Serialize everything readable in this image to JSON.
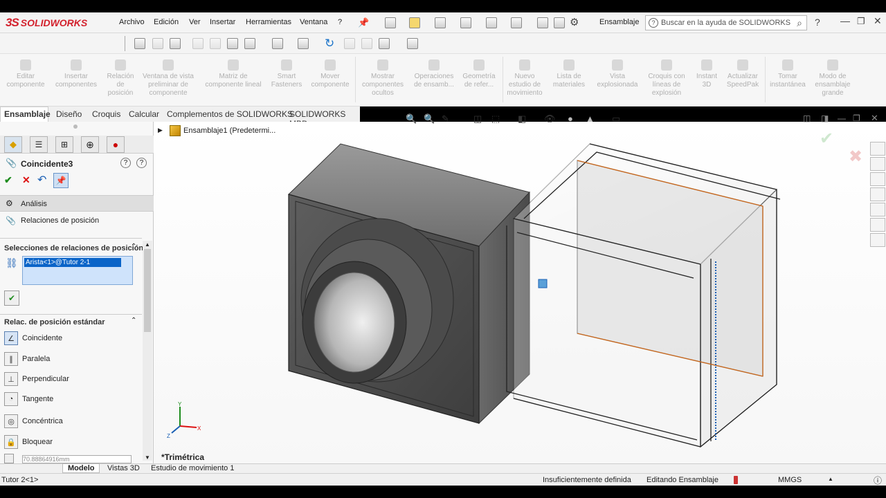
{
  "app": {
    "brand": "SOLIDWORKS",
    "brand_prefix": "3S"
  },
  "menu": [
    "Archivo",
    "Edición",
    "Ver",
    "Insertar",
    "Herramientas",
    "Ventana",
    "?"
  ],
  "doc_type": "Ensamblaje",
  "search": {
    "placeholder": "Buscar en la ayuda de SOLIDWORKS"
  },
  "commands": [
    "Editar componente",
    "Insertar componentes",
    "Relación de posición",
    "Ventana de vista preliminar de componente",
    "Matriz de componente lineal",
    "Smart Fasteners",
    "Mover componente",
    "Mostrar componentes ocultos",
    "Operaciones de ensamb...",
    "Geometría de refer...",
    "Nuevo estudio de movimiento",
    "Lista de materiales",
    "Vista explosionada",
    "Croquis con líneas de explosión",
    "Instant 3D",
    "Actualizar SpeedPak",
    "Tomar instantánea",
    "Modo de ensamblaje grande"
  ],
  "tabs": [
    "Ensamblaje",
    "Diseño",
    "Croquis",
    "Calcular",
    "Complementos de SOLIDWORKS",
    "SOLIDWORKS MBD"
  ],
  "panel": {
    "title": "Coincidente3",
    "analysis": "Análisis",
    "mates_label": "Relaciones de posición",
    "selections_header": "Selecciones de relaciones de posición",
    "selection_item": "Arista<1>@Tutor 2-1",
    "standard_header": "Relac. de posición estándar",
    "standard_mates": [
      "Coincidente",
      "Paralela",
      "Perpendicular",
      "Tangente",
      "Concéntrica",
      "Bloquear"
    ],
    "distance_value": "70.88864916mm"
  },
  "tree": {
    "root": "Ensamblaje1  (Predetermi..."
  },
  "view_label": "*Trimétrica",
  "bottom_tabs": [
    "Modelo",
    "Vistas 3D",
    "Estudio de movimiento 1"
  ],
  "status": {
    "left": "Tutor 2<1>",
    "state": "Insuficientemente definida",
    "mode": "Editando Ensamblaje",
    "units": "MMGS"
  },
  "colors": {
    "brand": "#d3212d",
    "accent": "#1a73c9",
    "selection": "#0a64c8"
  }
}
